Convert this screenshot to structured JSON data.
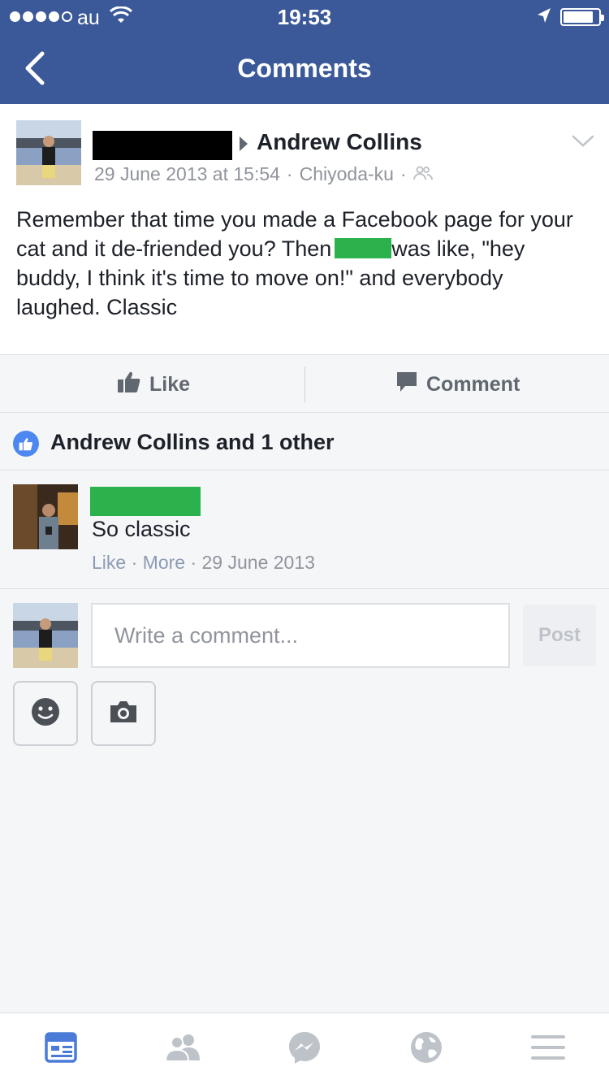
{
  "status_bar": {
    "carrier": "au",
    "time": "19:53",
    "battery_level": 0.85
  },
  "nav": {
    "title": "Comments"
  },
  "post": {
    "target_name": "Andrew Collins",
    "date": "29 June 2013 at 15:54",
    "location": "Chiyoda-ku",
    "separator": "·",
    "text_part1": "Remember that time you made a Facebook page for your cat and it de-friended you? Then",
    "text_part2": "was like, \"hey buddy, I think it's time to move on!\" and everybody laughed. Classic"
  },
  "actions": {
    "like_label": "Like",
    "comment_label": "Comment"
  },
  "likes": {
    "summary": "Andrew Collins and 1 other"
  },
  "comment": {
    "text": "So classic",
    "like_link": "Like",
    "more_link": "More",
    "date": "29 June 2013",
    "separator": "·"
  },
  "composer": {
    "placeholder": "Write a comment...",
    "post_label": "Post"
  },
  "colors": {
    "brand": "#3b5998",
    "tab_active": "#4b7bd8",
    "tab_inactive": "#bec3c9",
    "redaction_green": "#2bb24c"
  },
  "tabs": [
    {
      "icon": "news-feed-icon",
      "active": true
    },
    {
      "icon": "friends-icon",
      "active": false
    },
    {
      "icon": "messenger-icon",
      "active": false
    },
    {
      "icon": "globe-icon",
      "active": false
    },
    {
      "icon": "menu-icon",
      "active": false
    }
  ]
}
